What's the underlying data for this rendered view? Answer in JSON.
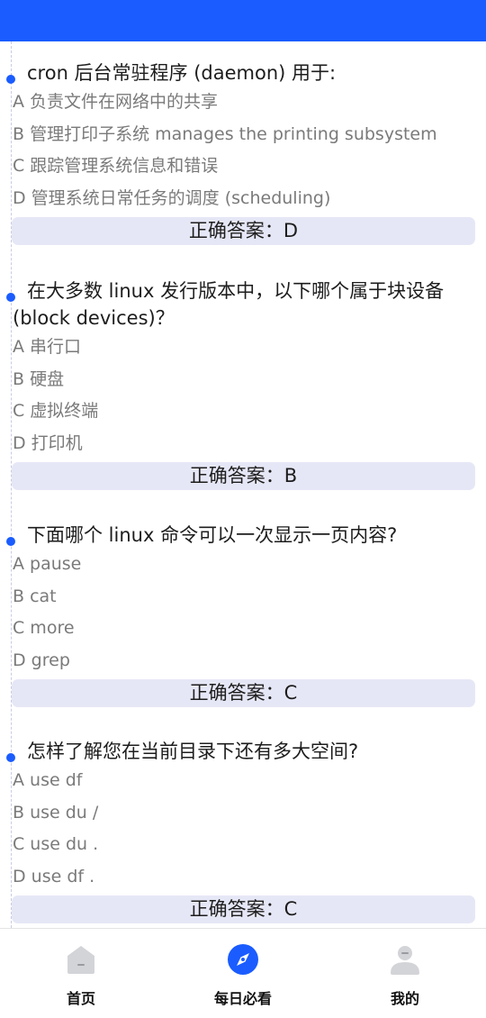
{
  "colors": {
    "accent": "#1a5cff",
    "answer_bg": "#e6e7f6",
    "option_text": "#7a7a7a"
  },
  "questions": [
    {
      "title": "cron 后台常驻程序 (daemon) 用于:",
      "options": [
        "A 负责文件在网络中的共享",
        "B 管理打印子系统 manages the printing subsystem",
        "C 跟踪管理系统信息和错误",
        "D 管理系统日常任务的调度 (scheduling)"
      ],
      "answer": "正确答案：D"
    },
    {
      "title": "在大多数 linux 发行版本中，以下哪个属于块设备 (block devices)？",
      "options": [
        "A 串行口",
        "B 硬盘",
        "C 虚拟终端",
        "D 打印机"
      ],
      "answer": "正确答案：B"
    },
    {
      "title": "下面哪个 linux 命令可以一次显示一页内容?",
      "options": [
        "A pause",
        "B cat",
        "C more",
        "D grep"
      ],
      "answer": "正确答案：C"
    },
    {
      "title": "怎样了解您在当前目录下还有多大空间?",
      "options": [
        "A use df",
        "B use du /",
        "C use du .",
        "D use df ."
      ],
      "answer": "正确答案：C"
    }
  ],
  "nav": {
    "items": [
      {
        "label": "首页",
        "icon": "home-icon"
      },
      {
        "label": "每日必看",
        "icon": "compass-icon"
      },
      {
        "label": "我的",
        "icon": "user-icon"
      }
    ],
    "active_index": 1
  }
}
